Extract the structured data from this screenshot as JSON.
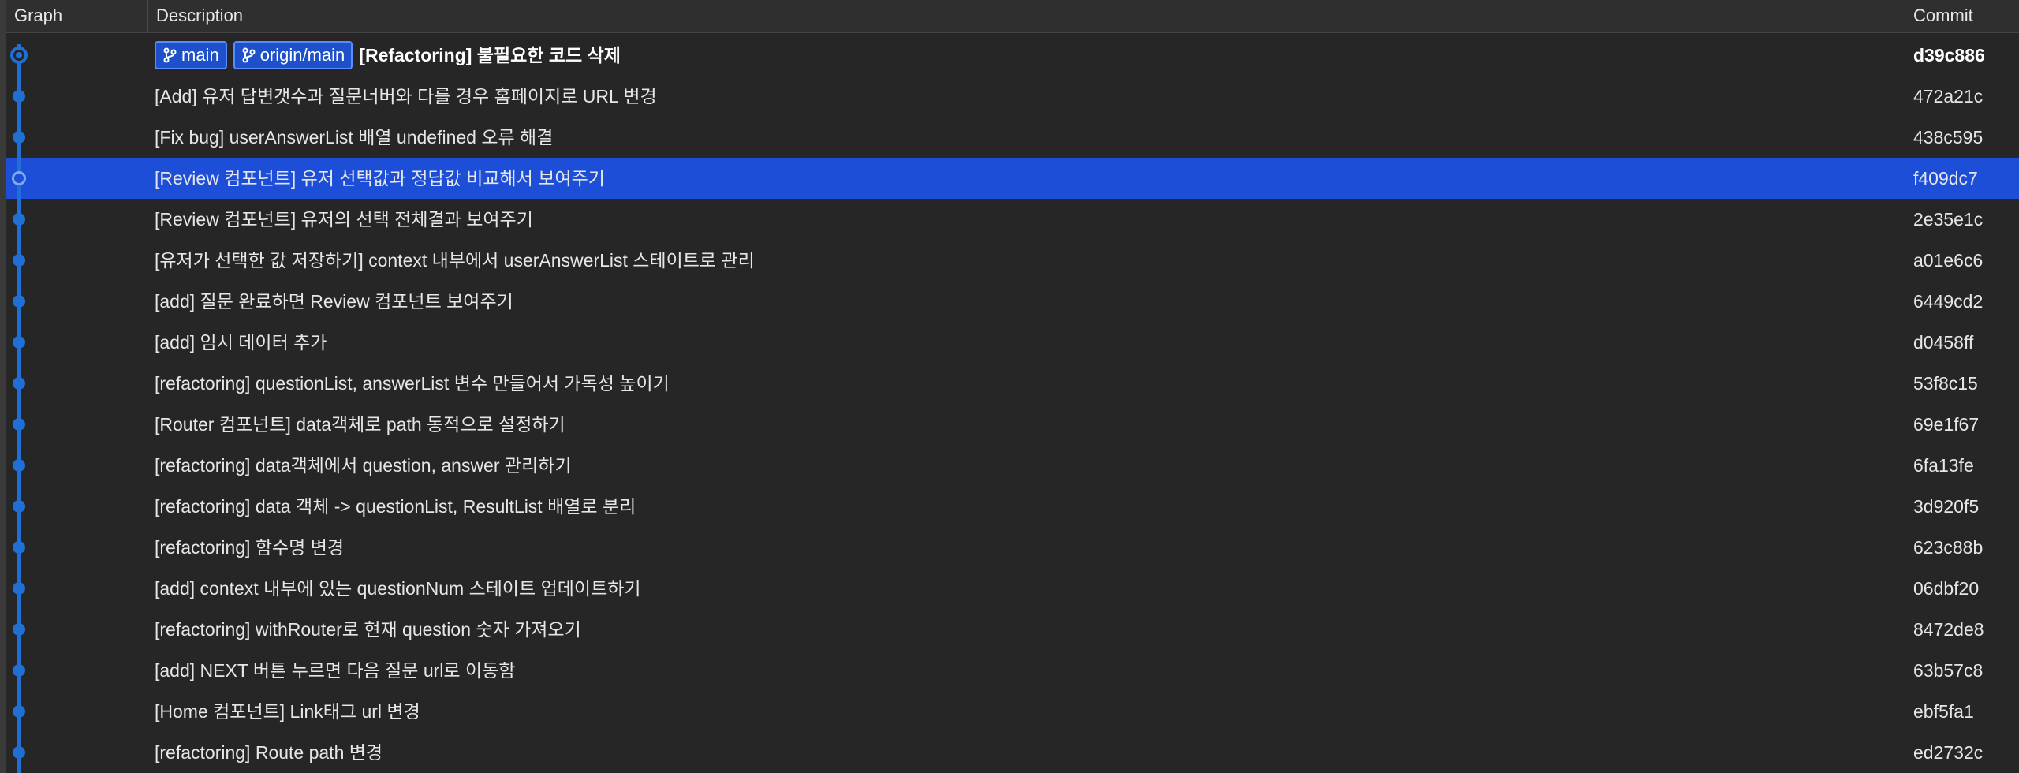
{
  "header": {
    "graph": "Graph",
    "description": "Description",
    "commit": "Commit"
  },
  "colors": {
    "background": "#262626",
    "selected_row": "#1d4ed8",
    "graph_line": "#1f6fd6",
    "badge": "#1e50c9"
  },
  "branches": [
    {
      "label": "main",
      "icon": "branch-icon"
    },
    {
      "label": "origin/main",
      "icon": "branch-icon"
    }
  ],
  "commits": [
    {
      "message": "[Refactoring] 불필요한 코드 삭제",
      "hash": "d39c886",
      "head": true
    },
    {
      "message": "[Add] 유저 답변갯수과 질문너버와 다를 경우 홈페이지로 URL 변경",
      "hash": "472a21c"
    },
    {
      "message": "[Fix bug] userAnswerList 배열 undefined 오류 해결",
      "hash": "438c595"
    },
    {
      "message": "[Review 컴포넌트] 유저 선택값과 정답값 비교해서 보여주기",
      "hash": "f409dc7",
      "selected": true
    },
    {
      "message": "[Review 컴포넌트] 유저의 선택 전체결과 보여주기",
      "hash": "2e35e1c"
    },
    {
      "message": "[유저가 선택한 값 저장하기] context 내부에서 userAnswerList 스테이트로 관리",
      "hash": "a01e6c6"
    },
    {
      "message": "[add] 질문 완료하면 Review  컴포넌트 보여주기",
      "hash": "6449cd2"
    },
    {
      "message": "[add] 임시 데이터 추가",
      "hash": "d0458ff"
    },
    {
      "message": "[refactoring] questionList, answerList 변수 만들어서 가독성 높이기",
      "hash": "53f8c15"
    },
    {
      "message": "[Router 컴포넌트] data객체로 path 동적으로 설정하기",
      "hash": "69e1f67"
    },
    {
      "message": "[refactoring] data객체에서 question, answer 관리하기",
      "hash": "6fa13fe"
    },
    {
      "message": "[refactoring] data 객체 ->  questionList, ResultList 배열로 분리",
      "hash": "3d920f5"
    },
    {
      "message": "[refactoring] 함수명 변경",
      "hash": "623c88b"
    },
    {
      "message": "[add]  context 내부에 있는 questionNum 스테이트 업데이트하기",
      "hash": "06dbf20"
    },
    {
      "message": "[refactoring]  withRouter로 현재 question 숫자 가져오기",
      "hash": "8472de8"
    },
    {
      "message": "[add] NEXT 버튼 누르면 다음 질문 url로 이동함",
      "hash": "63b57c8"
    },
    {
      "message": "[Home 컴포넌트] Link태그 url 변경",
      "hash": "ebf5fa1"
    },
    {
      "message": "[refactoring] Route path 변경",
      "hash": "ed2732c"
    }
  ]
}
